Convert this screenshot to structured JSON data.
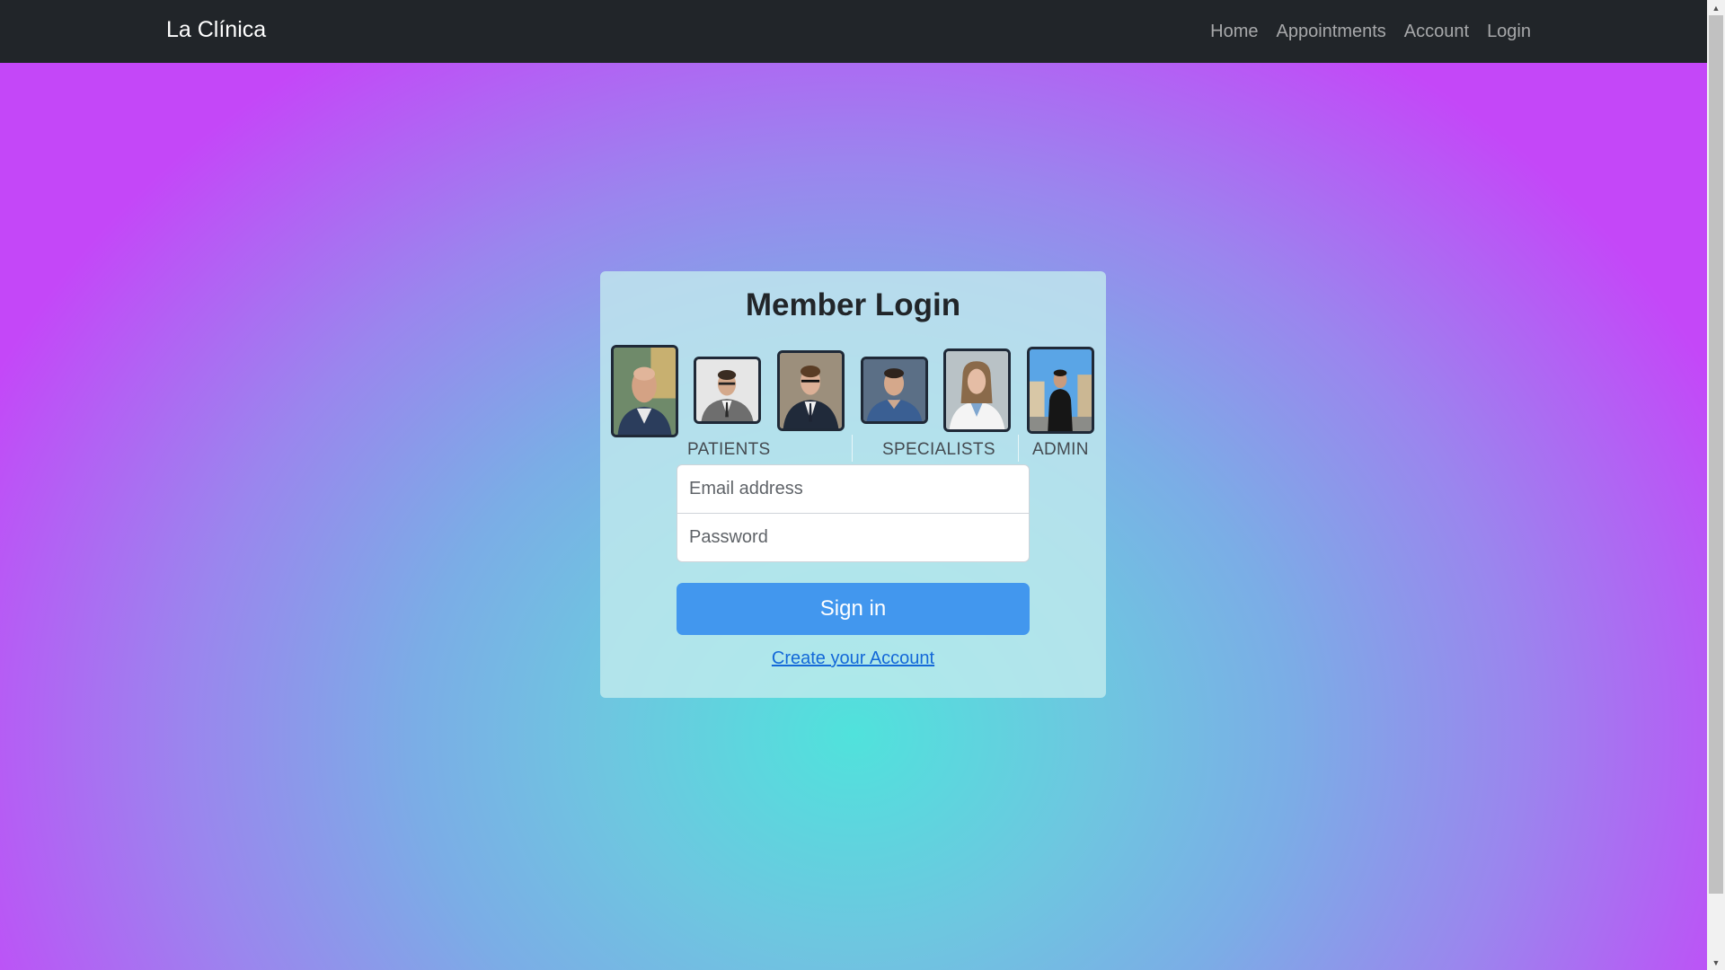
{
  "navbar": {
    "brand": "La Clínica",
    "links": [
      "Home",
      "Appointments",
      "Account",
      "Login"
    ]
  },
  "login": {
    "title": "Member Login",
    "groups": [
      "PATIENTS",
      "SPECIALISTS",
      "ADMIN"
    ],
    "email_placeholder": "Email address",
    "password_placeholder": "Password",
    "signin_label": "Sign in",
    "create_account_label": "Create your Account"
  },
  "colors": {
    "navbar": "#212529",
    "button": "#4297ee",
    "link": "#1368d8",
    "gradient_center": "#50e2dc",
    "gradient_edge": "#c447f8"
  }
}
